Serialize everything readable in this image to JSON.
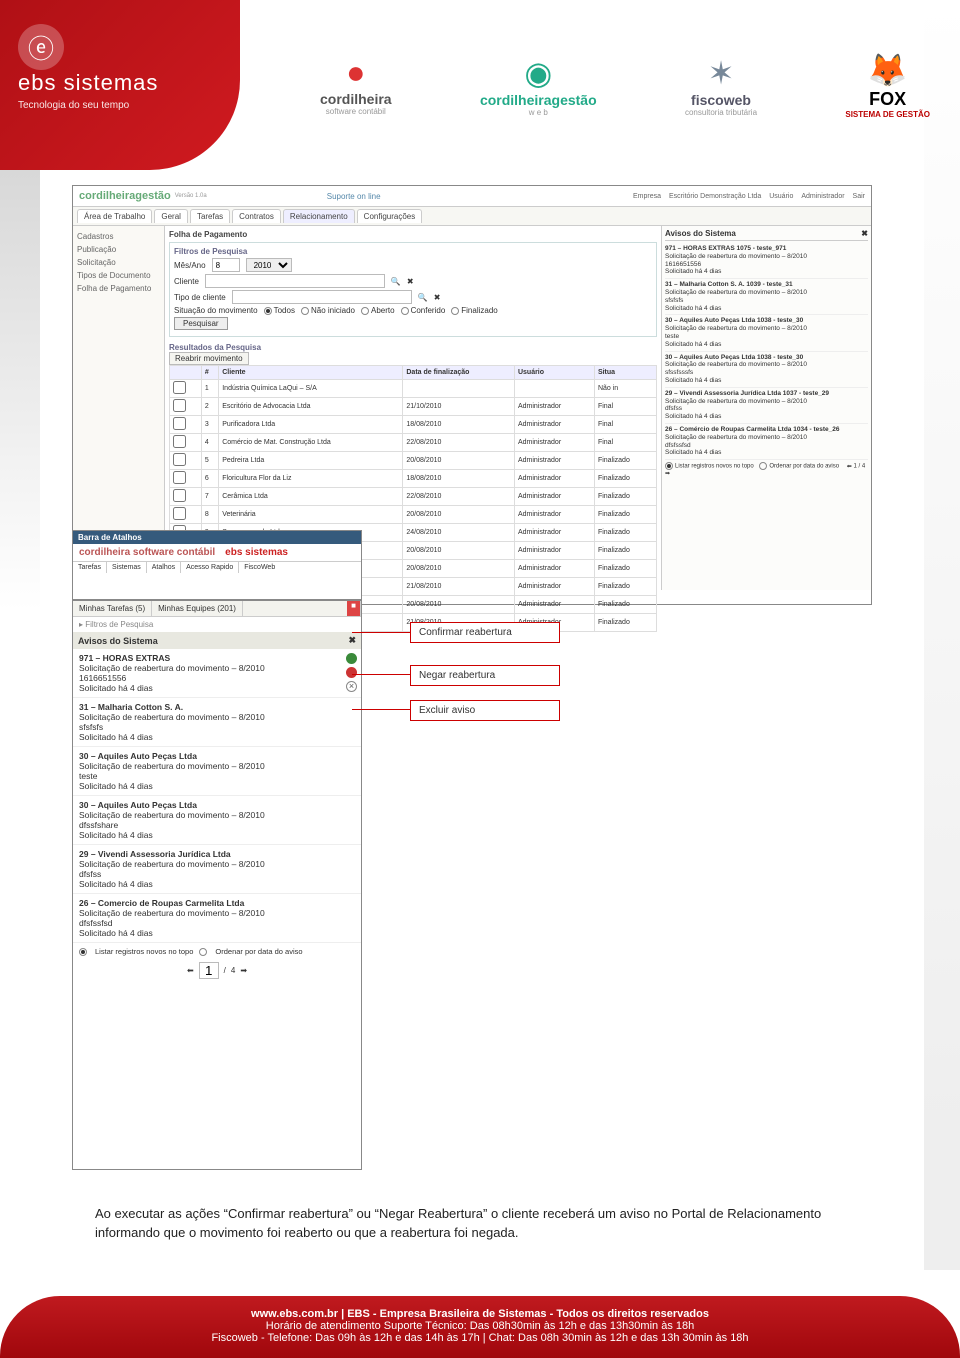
{
  "header": {
    "brand": "ebs sistemas",
    "tagline": "Tecnologia do seu tempo",
    "logo_glyph": "ⓔ"
  },
  "partners": [
    {
      "icon": "●",
      "title": "cordilheira",
      "sub": "software contábil",
      "color": "#d33"
    },
    {
      "icon": "◉",
      "title": "cordilheiragestão",
      "sub": "w e b",
      "color": "#2a8"
    },
    {
      "icon": "✶",
      "title": "fiscoweb",
      "sub": "consultoria tributária",
      "color": "#667"
    },
    {
      "icon": "🦊",
      "title": "FOX",
      "sub": "SISTEMA DE GESTÃO",
      "color": "#b00"
    }
  ],
  "mainPanel": {
    "brand": "cordilheiragestão",
    "version": "Versão 1.0a",
    "support": "Suporte on line",
    "topLinks": [
      "Empresa",
      "Escritório Demonstração Ltda",
      "Usuário",
      "Administrador",
      "Sair"
    ],
    "tabs": [
      "Área de Trabalho",
      "Geral",
      "Tarefas",
      "Contratos",
      "Relacionamento",
      "Configurações"
    ],
    "sideItems": [
      "Cadastros",
      "Publicação",
      "Solicitação",
      "Tipos de Documento",
      "Folha de Pagamento"
    ],
    "moduleTitle": "Folha de Pagamento",
    "filters": {
      "head": "Filtros de Pesquisa",
      "mesAno": "Mês/Ano",
      "mes": "8",
      "ano": "2010",
      "cliente": "Cliente",
      "tipo": "Tipo de cliente",
      "situacao": "Situação do movimento",
      "radios": [
        "Todos",
        "Não iniciado",
        "Aberto",
        "Conferido",
        "Finalizado"
      ],
      "btn": "Pesquisar"
    },
    "results": {
      "head": "Resultados da Pesquisa",
      "reopen": "Reabrir movimento",
      "cols": [
        "",
        "#",
        "Cliente",
        "Data de finalização",
        "Usuário",
        "Situa"
      ],
      "rows": [
        [
          "",
          "1",
          "Indústria Química LaQui – S/A",
          "",
          "",
          "Não in"
        ],
        [
          "",
          "2",
          "Escritório de Advocacia Ltda",
          "21/10/2010",
          "Administrador",
          "Final"
        ],
        [
          "",
          "3",
          "Purificadora Ltda",
          "18/08/2010",
          "Administrador",
          "Final"
        ],
        [
          "",
          "4",
          "Comércio de Mat. Construção Ltda",
          "22/08/2010",
          "Administrador",
          "Final"
        ],
        [
          "",
          "5",
          "Pedreira Ltda",
          "20/08/2010",
          "Administrador",
          "Finalizado"
        ],
        [
          "",
          "6",
          "Floricultura Flor da Liz",
          "18/08/2010",
          "Administrador",
          "Finalizado"
        ],
        [
          "",
          "7",
          "Cerâmica Ltda",
          "22/08/2010",
          "Administrador",
          "Finalizado"
        ],
        [
          "",
          "8",
          "Veterinária",
          "20/08/2010",
          "Administrador",
          "Finalizado"
        ],
        [
          "",
          "9",
          "Supermercado Ltda",
          "24/08/2010",
          "Administrador",
          "Finalizado"
        ],
        [
          "",
          "",
          "",
          "20/08/2010",
          "Administrador",
          "Finalizado"
        ],
        [
          "",
          "",
          "",
          "20/08/2010",
          "Administrador",
          "Finalizado"
        ],
        [
          "",
          "",
          "",
          "21/08/2010",
          "Administrador",
          "Finalizado"
        ],
        [
          "",
          "",
          "",
          "20/08/2010",
          "Administrador",
          "Finalizado"
        ],
        [
          "",
          "",
          "Ltda",
          "21/08/2010",
          "Administrador",
          "Finalizado"
        ]
      ]
    },
    "avisos": {
      "title": "Avisos do Sistema",
      "items": [
        {
          "t": "971 – HORAS EXTRAS 1075 - teste_971",
          "d": "Solicitação de reabertura do movimento – 8/2010",
          "c": "1616651556",
          "a": "Solicitado há 4 dias"
        },
        {
          "t": "31 – Malharia Cotton S. A. 1039 - teste_31",
          "d": "Solicitação de reabertura do movimento – 8/2010",
          "c": "sfsfsfs",
          "a": "Solicitado há 4 dias"
        },
        {
          "t": "30 – Aquiles Auto Peças Ltda 1038 - teste_30",
          "d": "Solicitação de reabertura do movimento – 8/2010",
          "c": "teste",
          "a": "Solicitado há 4 dias"
        },
        {
          "t": "30 – Aquiles Auto Peças Ltda 1038 - teste_30",
          "d": "Solicitação de reabertura do movimento – 8/2010",
          "c": "sfssfsssfs",
          "a": "Solicitado há 4 dias"
        },
        {
          "t": "29 – Vivendi Assessoria Jurídica Ltda 1037 - teste_29",
          "d": "Solicitação de reabertura do movimento – 8/2010",
          "c": "dfsfss",
          "a": "Solicitado há 4 dias"
        },
        {
          "t": "26 – Comércio de Roupas Carmelita Ltda 1034 - teste_26",
          "d": "Solicitação de reabertura do movimento – 8/2010",
          "c": "dfsfssfsd",
          "a": "Solicitado há 4 dias"
        }
      ],
      "footer": {
        "optA": "Listar registros novos no topo",
        "optB": "Ordenar por data do aviso",
        "page": "1",
        "total": "4"
      }
    }
  },
  "atalhos": {
    "bar": "Barra de Atalhos",
    "logos": [
      "cordilheira  software contábil",
      "ebs sistemas"
    ],
    "tabs": [
      "Tarefas",
      "Sistemas",
      "Atalhos",
      "Acesso Rapido",
      "FiscoWeb"
    ]
  },
  "secPanel": {
    "tabs": [
      "Minhas Tarefas (5)",
      "Minhas Equipes (201)"
    ],
    "filtros": "Filtros de Pesquisa",
    "avTitle": "Avisos do Sistema",
    "items": [
      {
        "t": "971 – HORAS EXTRAS",
        "d": "Solicitação de reabertura do movimento – 8/2010",
        "c": "1616651556",
        "a": "Solicitado há 4 dias"
      },
      {
        "t": "31 – Malharia Cotton S. A.",
        "d": "Solicitação de reabertura do movimento – 8/2010",
        "c": "sfsfsfs",
        "a": "Solicitado há 4 dias"
      },
      {
        "t": "30 – Aquiles Auto Peças Ltda",
        "d": "Solicitação de reabertura do movimento – 8/2010",
        "c": "teste",
        "a": "Solicitado há 4 dias"
      },
      {
        "t": "30 – Aquiles Auto Peças Ltda",
        "d": "Solicitação de reabertura do movimento – 8/2010",
        "c": "dfssfshare",
        "a": "Solicitado há 4 dias"
      },
      {
        "t": "29 – Vivendi Assessoria Jurídica Ltda",
        "d": "Solicitação de reabertura do movimento – 8/2010",
        "c": "dfsfss",
        "a": "Solicitado há 4 dias"
      },
      {
        "t": "26 – Comercio de Roupas Carmelita Ltda",
        "d": "Solicitação de reabertura do movimento – 8/2010",
        "c": "dfsfssfsd",
        "a": "Solicitado há 4 dias"
      }
    ],
    "footer": {
      "optA": "Listar registros novos no topo",
      "optB": "Ordenar por data do aviso",
      "page": "1",
      "total": "4"
    }
  },
  "callouts": {
    "confirm": "Confirmar reabertura",
    "deny": "Negar reabertura",
    "del": "Excluir aviso"
  },
  "bodyText": "Ao executar as ações “Confirmar reabertura” ou “Negar Reabertura” o cliente receberá um aviso no Portal de Relacionamento informando que o movimento foi reaberto ou que a reabertura foi negada.",
  "footer": {
    "l1": "www.ebs.com.br | EBS - Empresa Brasileira de Sistemas - Todos os direitos reservados",
    "l2": "Horário de atendimento Suporte Técnico: Das 08h30min às 12h e das 13h30min às 18h",
    "l3": "Fiscoweb - Telefone: Das 09h às 12h e das 14h às 17h | Chat: Das 08h 30min às 12h e das 13h 30min às 18h"
  }
}
